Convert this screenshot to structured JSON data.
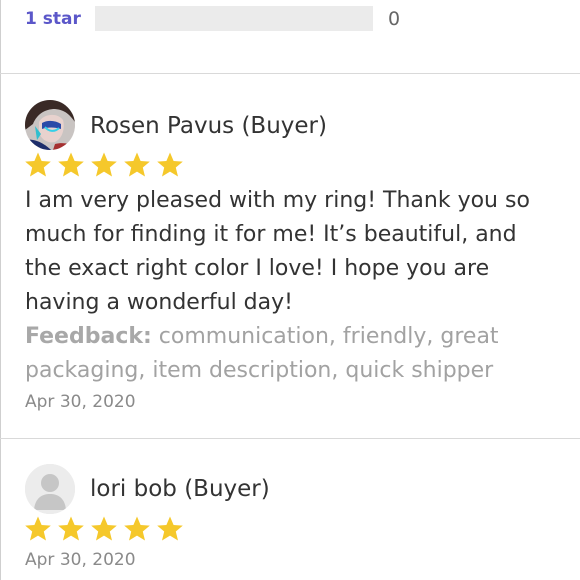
{
  "rating_summary": {
    "label": "1 star",
    "count": "0",
    "fill_fraction": 0
  },
  "reviews": [
    {
      "reviewer": "Rosen Pavus (Buyer)",
      "avatar": "photo-avatar",
      "stars": 5,
      "text": "I am very pleased with my ring! Thank you so much for finding it for me! It’s beautiful, and the exact right color I love! I hope you are having a wonderful day!",
      "feedback_label": "Feedback:",
      "feedback_items": "communication, friendly, great packaging, item description, quick shipper",
      "date": "Apr 30, 2020"
    },
    {
      "reviewer": "lori bob (Buyer)",
      "avatar": "default-user-avatar",
      "stars": 5,
      "date": "Apr 30, 2020"
    }
  ],
  "colors": {
    "star": "#f5c82b",
    "accent": "#5b57c9",
    "bar_empty": "#ebebeb",
    "divider": "#d9d9d9"
  },
  "icons": {
    "star": "star-icon"
  }
}
